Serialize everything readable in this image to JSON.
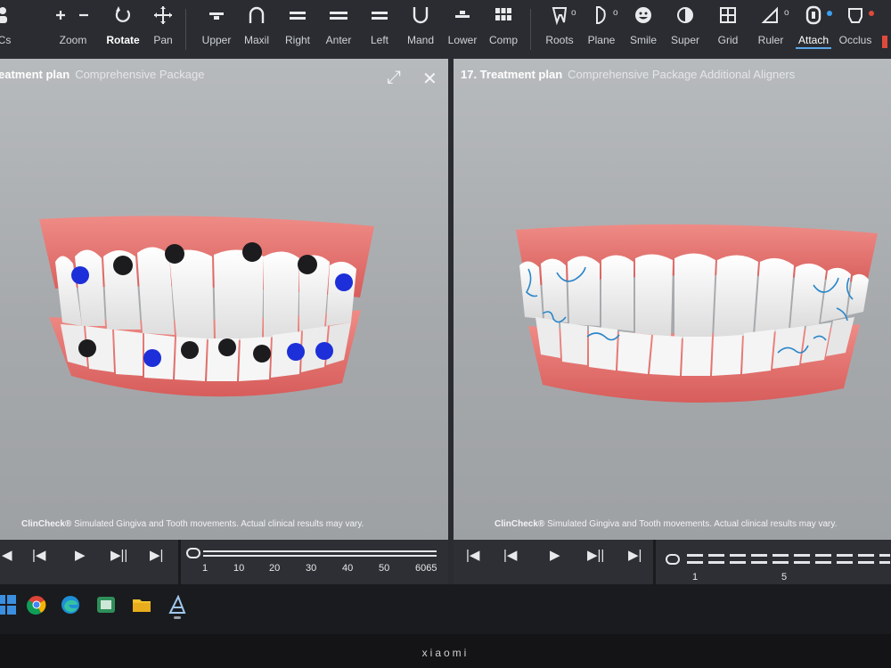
{
  "toolbar": {
    "items": [
      {
        "label": "Cs",
        "icon": "person-icon"
      },
      {
        "label": "Zoom",
        "icon": "zoom-icon"
      },
      {
        "label": "Rotate",
        "icon": "rotate-icon"
      },
      {
        "label": "Pan",
        "icon": "pan-icon"
      },
      {
        "label": "Upper",
        "icon": "upper-icon"
      },
      {
        "label": "Maxil",
        "icon": "maxil-icon"
      },
      {
        "label": "Right",
        "icon": "right-icon"
      },
      {
        "label": "Anter",
        "icon": "anter-icon"
      },
      {
        "label": "Left",
        "icon": "left-icon"
      },
      {
        "label": "Mand",
        "icon": "mand-icon"
      },
      {
        "label": "Lower",
        "icon": "lower-icon"
      },
      {
        "label": "Comp",
        "icon": "comp-icon"
      },
      {
        "label": "Roots",
        "icon": "roots-icon"
      },
      {
        "label": "Plane",
        "icon": "plane-icon"
      },
      {
        "label": "Smile",
        "icon": "smile-icon"
      },
      {
        "label": "Super",
        "icon": "super-icon"
      },
      {
        "label": "Grid",
        "icon": "grid-icon"
      },
      {
        "label": "Ruler",
        "icon": "ruler-icon"
      },
      {
        "label": "Attach",
        "icon": "attach-icon"
      },
      {
        "label": "Occlus",
        "icon": "occlus-icon"
      }
    ]
  },
  "left_panel": {
    "title": "eatment plan",
    "subtitle": "Comprehensive Package",
    "disclaimer_brand": "ClinCheck®",
    "disclaimer": "Simulated Gingiva and Tooth movements. Actual clinical results may vary."
  },
  "right_panel": {
    "title": "17. Treatment plan",
    "subtitle": "Comprehensive Package Additional Aligners",
    "disclaimer_brand": "ClinCheck®",
    "disclaimer": "Simulated Gingiva and Tooth movements. Actual clinical results may vary."
  },
  "left_timeline": {
    "ticks": [
      "1",
      "10",
      "20",
      "30",
      "40",
      "50",
      "6065"
    ]
  },
  "right_timeline": {
    "ticks": [
      "1",
      "5"
    ]
  },
  "taskbar": {
    "icons": [
      "windows-icon",
      "chrome-icon",
      "edge-icon",
      "app-icon",
      "folder-icon",
      "clincheck-icon"
    ]
  },
  "monitor": {
    "brand": "xiaomi"
  },
  "colors": {
    "attachment_dark": "#1c1c1e",
    "attachment_blue": "#1c2fd8",
    "ridge_line": "#2a86c9",
    "gum": "#e36f6b"
  }
}
